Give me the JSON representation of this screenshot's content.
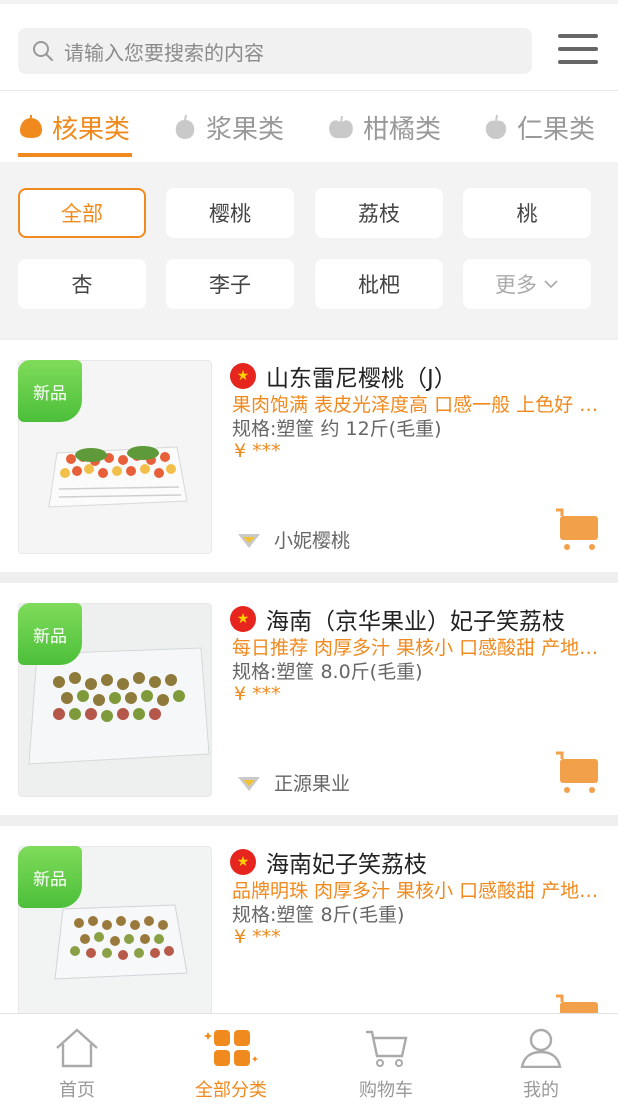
{
  "search": {
    "placeholder": "请输入您要搜索的内容",
    "icon": "search-icon"
  },
  "categories": [
    {
      "label": "核果类",
      "active": true
    },
    {
      "label": "浆果类",
      "active": false
    },
    {
      "label": "柑橘类",
      "active": false
    },
    {
      "label": "仁果类",
      "active": false
    }
  ],
  "filters": [
    "全部",
    "樱桃",
    "荔枝",
    "桃",
    "杏",
    "李子",
    "枇杷"
  ],
  "filter_more": "更多",
  "badge_label": "新品",
  "currency": "¥",
  "price_masked": "***",
  "products": [
    {
      "title": "山东雷尼樱桃（J）",
      "desc": "果肉饱满 表皮光泽度高 口感一般 上色好 产地直供",
      "spec": "规格:塑筐 约 12斤(毛重)",
      "seller": "小妮樱桃"
    },
    {
      "title": "海南（京华果业）妃子笑荔枝",
      "desc": "每日推荐 肉厚多汁 果核小 口感酸甜 产地直发",
      "spec": "规格:塑筐 8.0斤(毛重)",
      "seller": "正源果业"
    },
    {
      "title": "海南妃子笑荔枝",
      "desc": "品牌明珠 肉厚多汁 果核小 口感酸甜 产地直发",
      "spec": "规格:塑筐 8斤(毛重)",
      "seller": ""
    }
  ],
  "nav": [
    {
      "label": "首页",
      "icon": "home-icon",
      "active": false
    },
    {
      "label": "全部分类",
      "icon": "category-grid-icon",
      "active": true
    },
    {
      "label": "购物车",
      "icon": "cart-icon",
      "active": false
    },
    {
      "label": "我的",
      "icon": "user-icon",
      "active": false
    }
  ],
  "colors": {
    "accent": "#f08a1e",
    "badge_green": "#4cbf3a",
    "flag_red": "#e5251e"
  }
}
